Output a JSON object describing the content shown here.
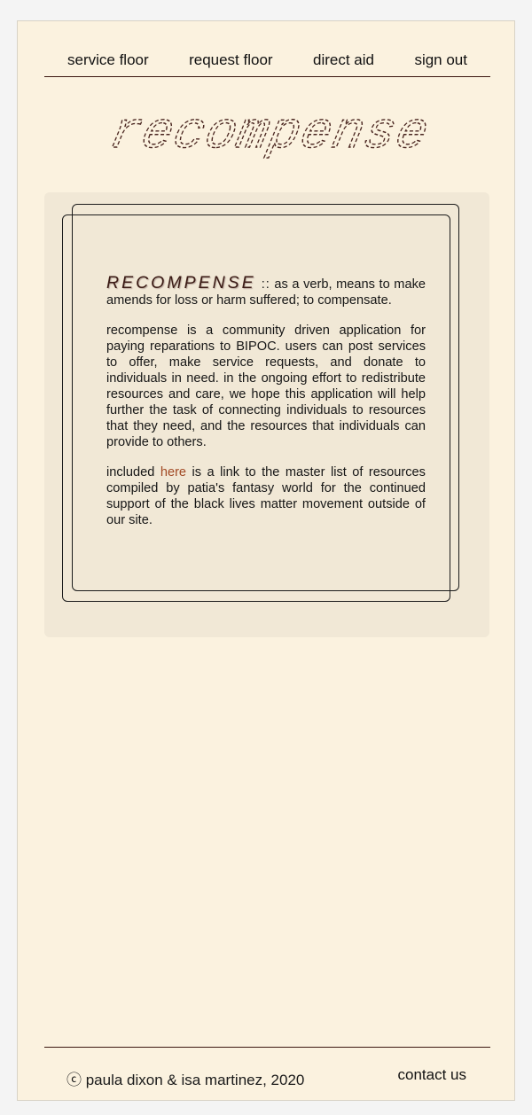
{
  "nav": {
    "items": [
      {
        "label": "service floor"
      },
      {
        "label": "request floor"
      },
      {
        "label": "direct aid"
      },
      {
        "label": "sign out"
      }
    ]
  },
  "logo": {
    "text": "recompense",
    "color": "#4a2620"
  },
  "about": {
    "word": "RECOMPENSE",
    "separator": "::",
    "definition": "as a verb, means to make amends for loss or harm suffered; to compensate.",
    "paragraph2": "recompense is a community driven application for paying reparations to BIPOC. users can post services to offer, make service requests, and donate to individuals in need. in the ongoing effort to redistribute resources and care, we hope this application will help further the task of connecting individuals to resources that they need, and the resources that individuals can provide to others.",
    "p3_before": "included",
    "p3_link": "here",
    "p3_after": "is a link to the master list of resources compiled by patia's fantasy world for the continued support of the black lives matter movement outside of our site."
  },
  "footer": {
    "copyright": "ⓒ paula dixon & isa martinez, 2020",
    "contact": "contact us"
  },
  "colors": {
    "background": "#fbf2df",
    "panel": "#f1e8d6",
    "accent": "#a24a25",
    "rule": "#3b1710"
  }
}
